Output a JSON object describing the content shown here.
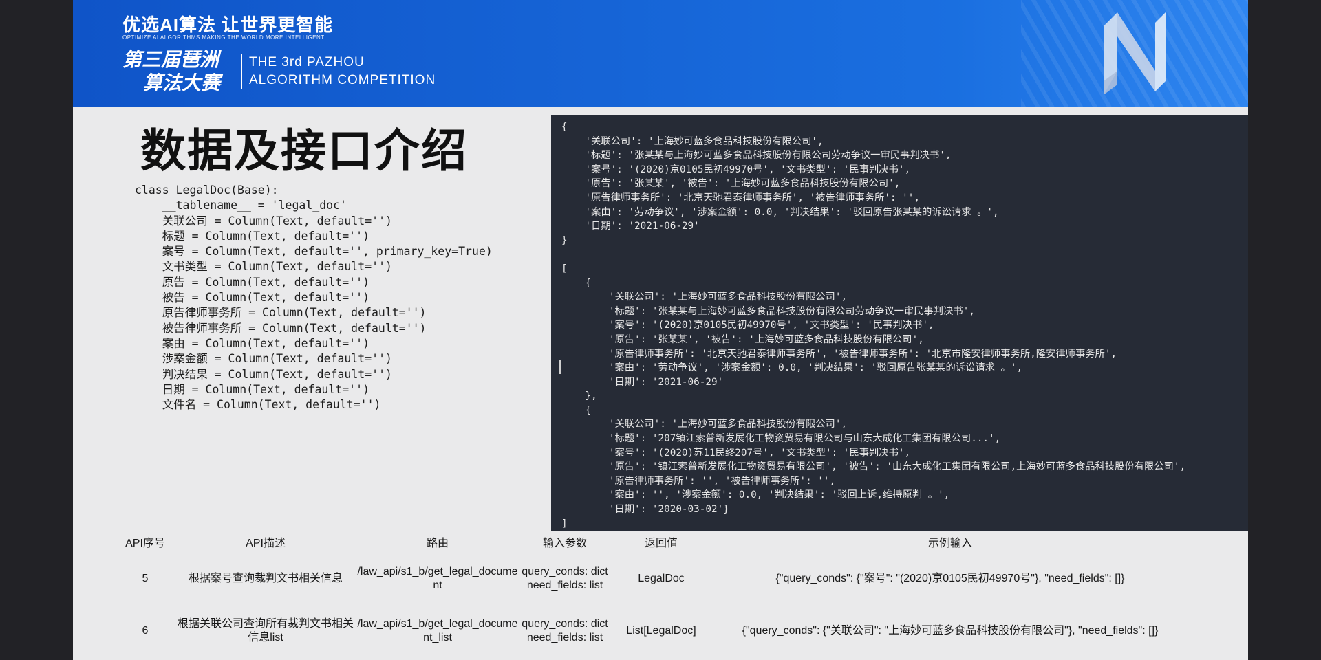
{
  "banner": {
    "slogan_cn": "优选AI算法 让世界更智能",
    "slogan_en": "OPTIMIZE AI ALGORITHMS   MAKING THE WORLD MORE INTELLIGENT",
    "competition_cn_line1": "第三届琶洲",
    "competition_cn_line2": "算法大赛",
    "competition_en_line1": "THE 3rd PAZHOU",
    "competition_en_line2": "ALGORITHM COMPETITION",
    "logo_letter": "N"
  },
  "title": "数据及接口介绍",
  "code": "class LegalDoc(Base):\n    __tablename__ = 'legal_doc'\n    关联公司 = Column(Text, default='')\n    标题 = Column(Text, default='')\n    案号 = Column(Text, default='', primary_key=True)\n    文书类型 = Column(Text, default='')\n    原告 = Column(Text, default='')\n    被告 = Column(Text, default='')\n    原告律师事务所 = Column(Text, default='')\n    被告律师事务所 = Column(Text, default='')\n    案由 = Column(Text, default='')\n    涉案金额 = Column(Text, default='')\n    判决结果 = Column(Text, default='')\n    日期 = Column(Text, default='')\n    文件名 = Column(Text, default='')",
  "terminal": "{\n    '关联公司': '上海妙可蓝多食品科技股份有限公司',\n    '标题': '张某某与上海妙可蓝多食品科技股份有限公司劳动争议一审民事判决书',\n    '案号': '(2020)京0105民初49970号', '文书类型': '民事判决书',\n    '原告': '张某某', '被告': '上海妙可蓝多食品科技股份有限公司',\n    '原告律师事务所': '北京天驰君泰律师事务所', '被告律师事务所': '',\n    '案由': '劳动争议', '涉案金额': 0.0, '判决结果': '驳回原告张某某的诉讼请求 。',\n    '日期': '2021-06-29'\n}\n\n[\n    {\n        '关联公司': '上海妙可蓝多食品科技股份有限公司',\n        '标题': '张某某与上海妙可蓝多食品科技股份有限公司劳动争议一审民事判决书',\n        '案号': '(2020)京0105民初49970号', '文书类型': '民事判决书',\n        '原告': '张某某', '被告': '上海妙可蓝多食品科技股份有限公司',\n        '原告律师事务所': '北京天驰君泰律师事务所', '被告律师事务所': '北京市隆安律师事务所,隆安律师事务所',\n        '案由': '劳动争议', '涉案金额': 0.0, '判决结果': '驳回原告张某某的诉讼请求 。',\n        '日期': '2021-06-29'\n    },\n    {\n        '关联公司': '上海妙可蓝多食品科技股份有限公司',\n        '标题': '207镇江索普新发展化工物资贸易有限公司与山东大成化工集团有限公司...',\n        '案号': '(2020)苏11民终207号', '文书类型': '民事判决书',\n        '原告': '镇江索普新发展化工物资贸易有限公司', '被告': '山东大成化工集团有限公司,上海妙可蓝多食品科技股份有限公司',\n        '原告律师事务所': '', '被告律师事务所': '',\n        '案由': '', '涉案金额': 0.0, '判决结果': '驳回上诉,维持原判 。',\n        '日期': '2020-03-02'}\n]",
  "table": {
    "headers": [
      "API序号",
      "API描述",
      "路由",
      "输入参数",
      "返回值",
      "示例输入"
    ],
    "rows": [
      {
        "id": "5",
        "desc": "根据案号查询裁判文书相关信息",
        "route": "/law_api/s1_b/get_legal_document",
        "params": "query_conds: dict need_fields: list",
        "returns": "LegalDoc",
        "example": "{\"query_conds\": {\"案号\": \"(2020)京0105民初49970号\"}, \"need_fields\": []}"
      },
      {
        "id": "6",
        "desc": "根据关联公司查询所有裁判文书相关信息list",
        "route": "/law_api/s1_b/get_legal_document_list",
        "params": "query_conds: dict need_fields: list",
        "returns": "List[LegalDoc]",
        "example": "{\"query_conds\": {\"关联公司\": \"上海妙可蓝多食品科技股份有限公司\"}, \"need_fields\": []}"
      }
    ]
  },
  "colors": {
    "banner_blue": "#1664d6",
    "slide_bg": "#eaeaeb",
    "terminal_bg": "#262b36",
    "outer_bg": "#222226"
  }
}
